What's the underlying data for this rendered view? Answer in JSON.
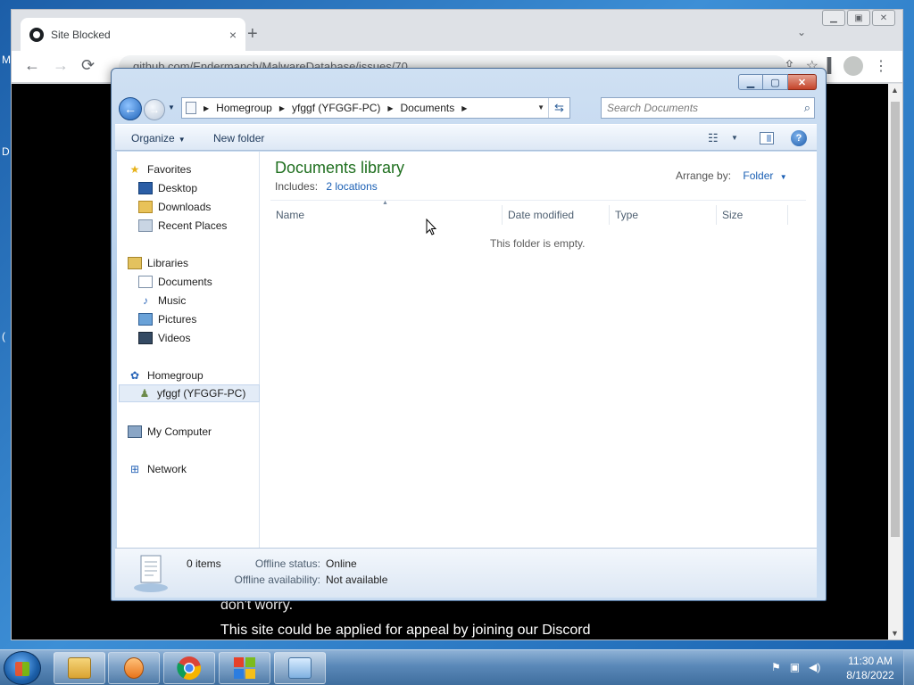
{
  "desktop": {
    "stub_top": "M",
    "stub_mid": "D",
    "stub_low": "("
  },
  "browser": {
    "tab_title": "Site Blocked",
    "tab_close": "×",
    "new_tab": "+",
    "tab_search": "⌄",
    "url": "github.com/Endermanch/MalwareDatabase/issues/70",
    "back": "←",
    "forward": "→",
    "reload": "⟳",
    "page_line1": "don't worry.",
    "page_line2": "This site could be applied for appeal by joining our Discord"
  },
  "explorer": {
    "breadcrumb": [
      "Homegroup",
      "yfggf (YFGGF-PC)",
      "Documents"
    ],
    "search_placeholder": "Search Documents",
    "organize_label": "Organize",
    "new_folder_label": "New folder",
    "nav": {
      "favorites": "Favorites",
      "desktop": "Desktop",
      "downloads": "Downloads",
      "recent_places": "Recent Places",
      "libraries": "Libraries",
      "documents": "Documents",
      "music": "Music",
      "pictures": "Pictures",
      "videos": "Videos",
      "homegroup": "Homegroup",
      "user": "yfggf (YFGGF-PC)",
      "my_computer": "My Computer",
      "network": "Network"
    },
    "library_title": "Documents library",
    "includes_label": "Includes:",
    "includes_link": "2 locations",
    "arrange_label": "Arrange by:",
    "arrange_value": "Folder",
    "columns": [
      "Name",
      "Date modified",
      "Type",
      "Size"
    ],
    "empty_text": "This folder is empty.",
    "details": {
      "count": "0 items",
      "offline_status_label": "Offline status:",
      "offline_status_value": "Online",
      "offline_availability_label": "Offline availability:",
      "offline_availability_value": "Not available"
    }
  },
  "taskbar": {
    "time": "11:30 AM",
    "date": "8/18/2022",
    "colors": {
      "explorer": "#e8b84a",
      "wmp": "#f08a24",
      "chrome_red": "#db4437",
      "chrome_green": "#0f9d58",
      "chrome_yellow": "#f4b400",
      "chrome_blue": "#4285f4"
    }
  }
}
